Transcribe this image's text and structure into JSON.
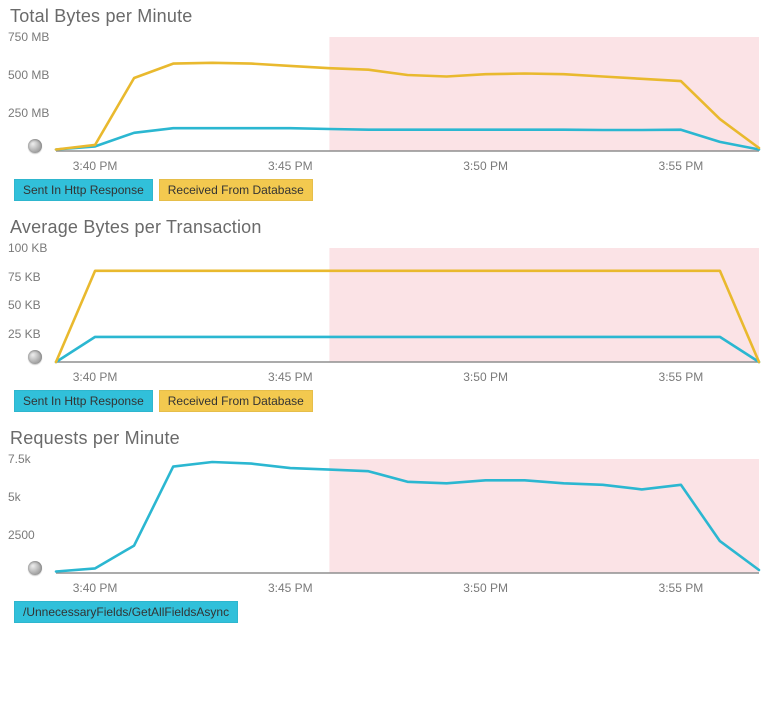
{
  "x_categories_min": [
    39,
    40,
    41,
    42,
    43,
    44,
    45,
    46,
    47,
    48,
    49,
    50,
    51,
    52,
    53,
    54,
    55,
    56,
    57
  ],
  "x_tick_labels": [
    "3:40 PM",
    "3:45 PM",
    "3:50 PM",
    "3:55 PM"
  ],
  "x_tick_positions_min": [
    40,
    45,
    50,
    55
  ],
  "highlight_start_min": 46,
  "colors": {
    "teal": "#2bb7d1",
    "yellow": "#e9b92e",
    "highlight": "#fbe3e6",
    "axis": "#8f8f8f"
  },
  "chart_data": [
    {
      "id": "total_bytes",
      "title": "Total Bytes per Minute",
      "type": "line",
      "ylim": [
        0,
        750
      ],
      "y_ticks": [
        250,
        500,
        750
      ],
      "y_tick_labels": [
        "250 MB",
        "500 MB",
        "750 MB"
      ],
      "legends": [
        {
          "label": "Sent In Http Response",
          "class": "leg-teal"
        },
        {
          "label": "Received From Database",
          "class": "leg-yellow"
        }
      ],
      "series": [
        {
          "name": "Sent In Http Response",
          "color_key": "teal",
          "values": [
            10,
            30,
            120,
            150,
            150,
            150,
            150,
            145,
            140,
            140,
            140,
            140,
            140,
            140,
            138,
            138,
            140,
            60,
            10
          ]
        },
        {
          "name": "Received From Database",
          "color_key": "yellow",
          "values": [
            10,
            40,
            480,
            575,
            580,
            575,
            560,
            545,
            535,
            500,
            490,
            505,
            510,
            505,
            490,
            475,
            460,
            210,
            20
          ]
        }
      ]
    },
    {
      "id": "avg_bytes",
      "title": "Average Bytes per Transaction",
      "type": "line",
      "ylim": [
        0,
        100
      ],
      "y_ticks": [
        25,
        50,
        75,
        100
      ],
      "y_tick_labels": [
        "25 KB",
        "50 KB",
        "75 KB",
        "100 KB"
      ],
      "legends": [
        {
          "label": "Sent In Http Response",
          "class": "leg-teal"
        },
        {
          "label": "Received From Database",
          "class": "leg-yellow"
        }
      ],
      "series": [
        {
          "name": "Sent In Http Response",
          "color_key": "teal",
          "values": [
            0,
            22,
            22,
            22,
            22,
            22,
            22,
            22,
            22,
            22,
            22,
            22,
            22,
            22,
            22,
            22,
            22,
            22,
            0
          ]
        },
        {
          "name": "Received From Database",
          "color_key": "yellow",
          "values": [
            0,
            80,
            80,
            80,
            80,
            80,
            80,
            80,
            80,
            80,
            80,
            80,
            80,
            80,
            80,
            80,
            80,
            80,
            0
          ]
        }
      ]
    },
    {
      "id": "requests",
      "title": "Requests per Minute",
      "type": "line",
      "ylim": [
        0,
        7500
      ],
      "y_ticks": [
        2500,
        5000,
        7500
      ],
      "y_tick_labels": [
        "2500",
        "5k",
        "7.5k"
      ],
      "legends": [
        {
          "label": "/UnnecessaryFields/GetAllFieldsAsync",
          "class": "leg-teal"
        }
      ],
      "series": [
        {
          "name": "/UnnecessaryFields/GetAllFieldsAsync",
          "color_key": "teal",
          "values": [
            100,
            300,
            1800,
            7000,
            7300,
            7200,
            6900,
            6800,
            6700,
            6000,
            5900,
            6100,
            6100,
            5900,
            5800,
            5500,
            5800,
            2100,
            200
          ]
        }
      ]
    }
  ]
}
